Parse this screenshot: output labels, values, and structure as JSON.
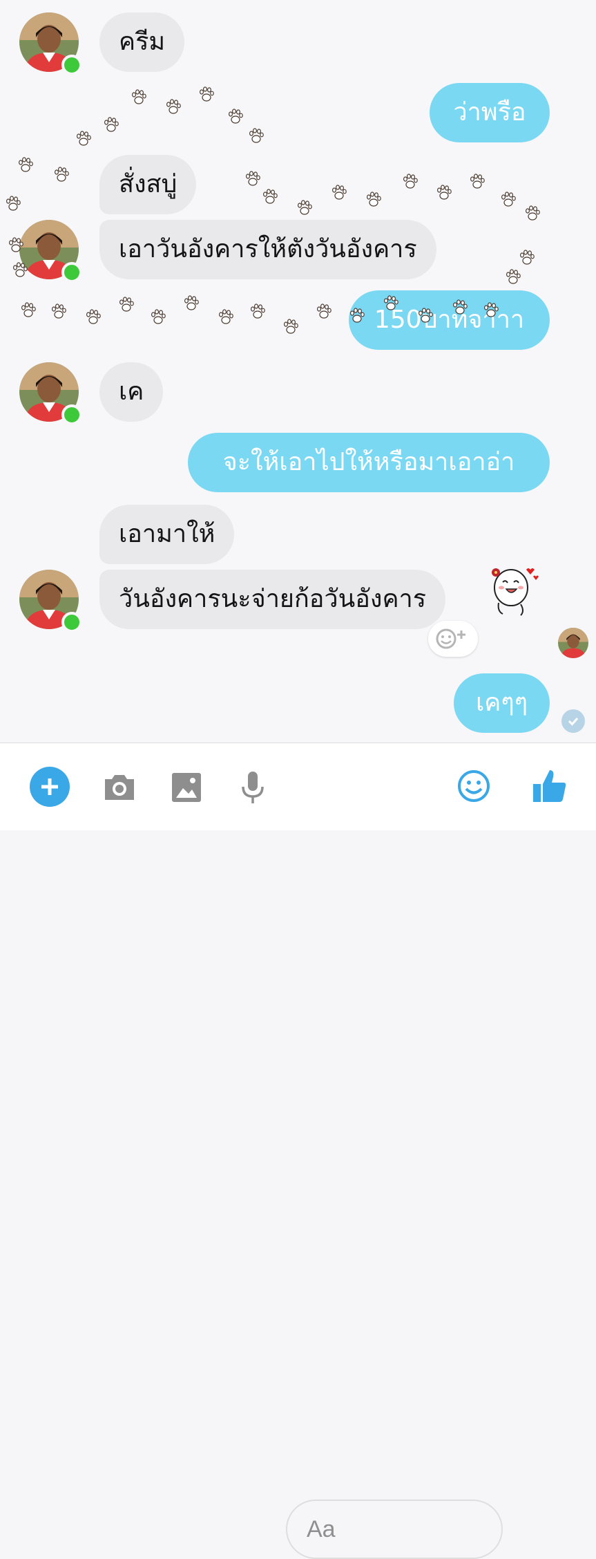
{
  "messages": [
    {
      "side": "in",
      "text": "ครีม"
    },
    {
      "side": "out",
      "text": "ว่าพรือ"
    },
    {
      "side": "in",
      "text": "สั่งสบู่"
    },
    {
      "side": "in",
      "text": "เอาวันอังคารให้ตังวันอังคาร"
    },
    {
      "side": "out",
      "text": "150บาทจาาา"
    },
    {
      "side": "in",
      "text": "เค"
    },
    {
      "side": "out",
      "text": "จะให้เอาไปให้หรือมาเอาอ่า"
    },
    {
      "side": "in",
      "text": "เอามาให้"
    },
    {
      "side": "in",
      "text": "วันอังคารนะจ่ายก้อวันอังคาร"
    },
    {
      "side": "out",
      "text": "เคๆๆ"
    }
  ],
  "composer": {
    "placeholder": "Aa"
  },
  "colors": {
    "outgoing_bubble": "#7ad8f3",
    "incoming_bubble": "#e9e9ec",
    "accent": "#3aa7e6",
    "online": "#3ec93b"
  },
  "icons": [
    "plus-icon",
    "camera-icon",
    "image-icon",
    "microphone-icon",
    "emoji-icon",
    "thumbs-up-icon",
    "add-reaction-icon",
    "seen-check-icon",
    "paw-print-icon"
  ]
}
